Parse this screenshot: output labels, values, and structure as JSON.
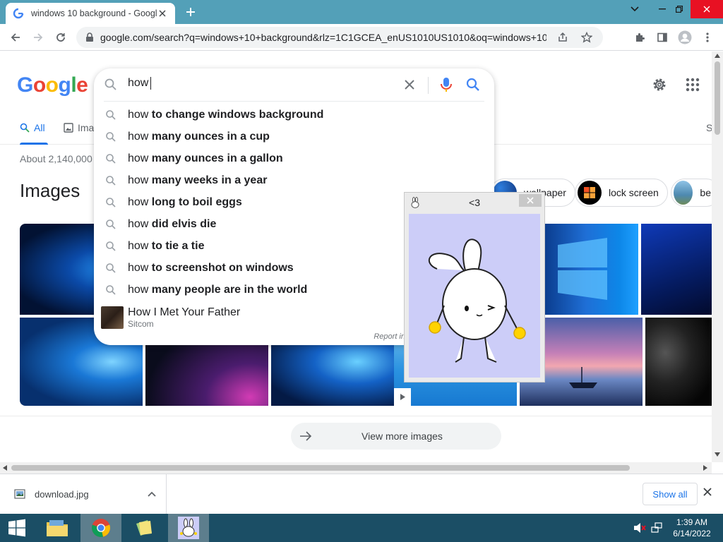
{
  "browser": {
    "tab_title": "windows 10 background - Google",
    "url": "google.com/search?q=windows+10+background&rlz=1C1GCEA_enUS1010US1010&oq=windows+10+bac..."
  },
  "search": {
    "query": "how",
    "suggestions": [
      {
        "prefix": "how ",
        "bold": "to change windows background"
      },
      {
        "prefix": "how ",
        "bold": "many ounces in a cup"
      },
      {
        "prefix": "how ",
        "bold": "many ounces in a gallon"
      },
      {
        "prefix": "how ",
        "bold": "many weeks in a year"
      },
      {
        "prefix": "how ",
        "bold": "long to boil eggs"
      },
      {
        "prefix": "how ",
        "bold": "did elvis die"
      },
      {
        "prefix": "how ",
        "bold": "to tie a tie"
      },
      {
        "prefix": "how ",
        "bold": "to screenshot on windows"
      },
      {
        "prefix": "how ",
        "bold": "many people are in the world"
      }
    ],
    "entity": {
      "title": "How I Met Your Father",
      "subtitle": "Sitcom"
    },
    "report": "Report in"
  },
  "tabs": {
    "all": "All",
    "images": "Ima",
    "more": "S"
  },
  "results": {
    "stats": "About 2,140,000",
    "images_heading": "Images",
    "chips": [
      "wallpaper",
      "lock screen",
      "be"
    ],
    "view_more": "View more images"
  },
  "widget": {
    "title": "<3"
  },
  "downloads": {
    "file": "download.jpg",
    "show_all": "Show all"
  },
  "taskbar": {
    "time": "1:39 AM",
    "date": "6/14/2022"
  },
  "colors": {
    "tabstrip": "#53a0b8",
    "taskbar": "#1b4e65",
    "link_blue": "#1a73e8"
  }
}
